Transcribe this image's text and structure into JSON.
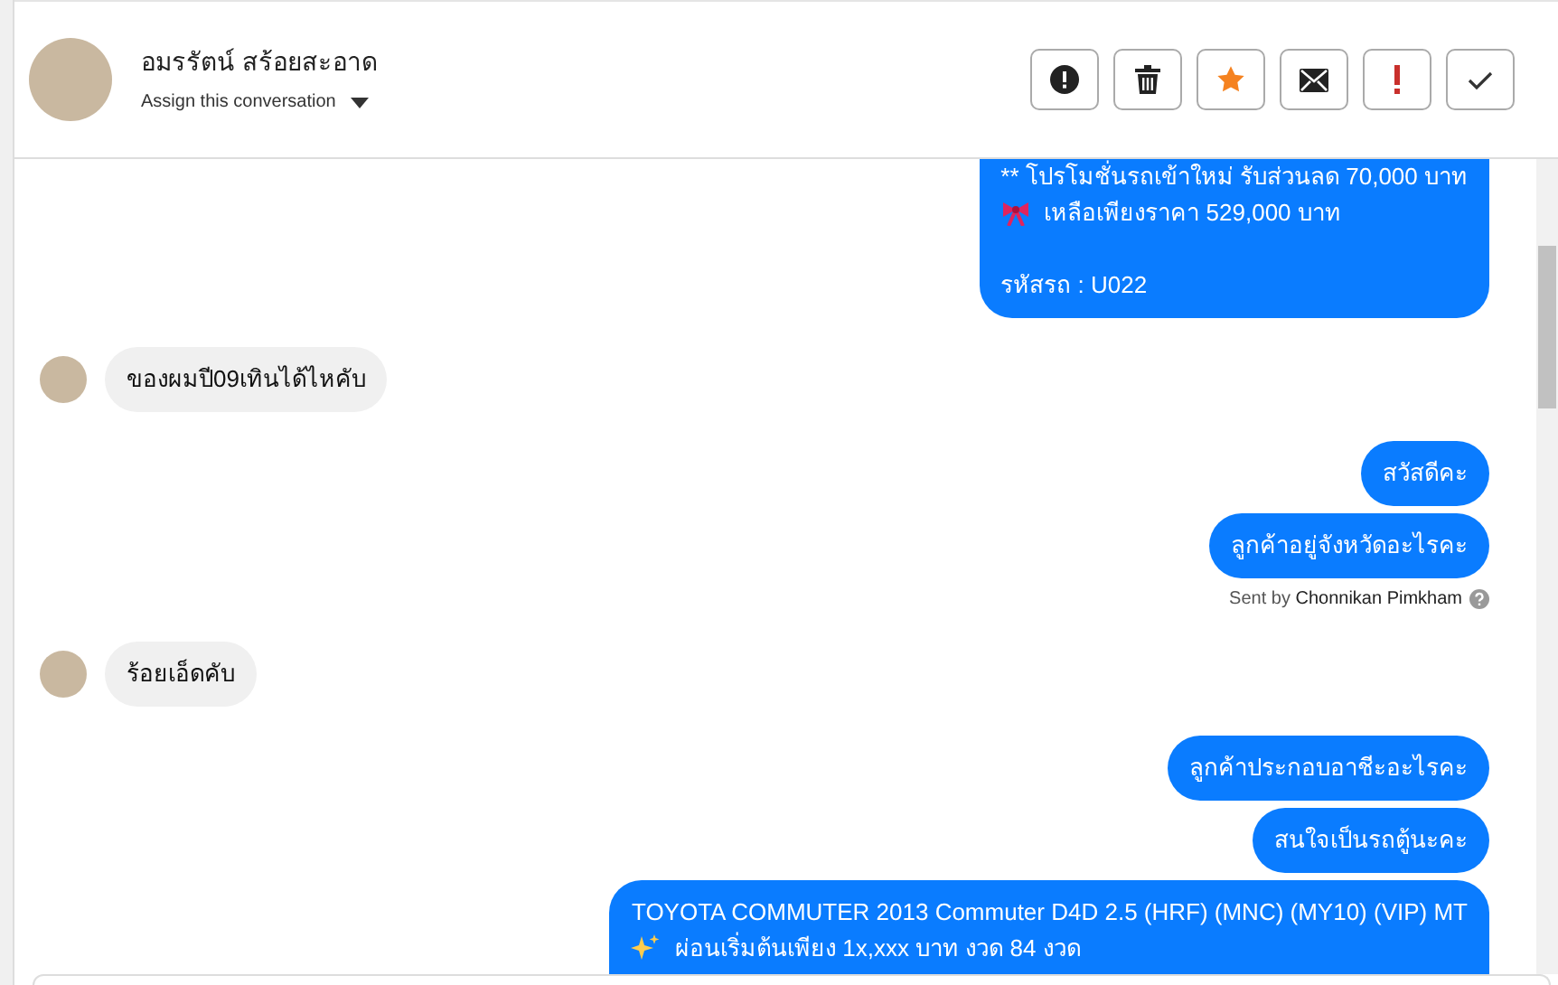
{
  "header": {
    "contact_name": "อมรรัตน์ สร้อยสะอาด",
    "assign_label": "Assign this conversation",
    "actions": [
      {
        "kind": "info"
      },
      {
        "kind": "delete"
      },
      {
        "kind": "star"
      },
      {
        "kind": "mail"
      },
      {
        "kind": "urgent"
      },
      {
        "kind": "check"
      }
    ]
  },
  "messages": [
    {
      "kind": "outgoing",
      "lines": [
        {
          "text": "** โปรโมชั่นรถเข้าใหม่ รับส่วนลด 70,000 บาท"
        },
        {
          "kind": "ribbon",
          "text": "เหลือเพียงราคา 529,000 บาท"
        },
        {
          "kind": "blank"
        },
        {
          "text": "รหัสรถ : U022"
        }
      ]
    },
    {
      "kind": "incoming",
      "lines": [
        {
          "text": "ของผมปี09เทินได้ไหคับ"
        }
      ]
    },
    {
      "kind": "outgoing",
      "lines": [
        {
          "text": "สวัสดีคะ"
        }
      ]
    },
    {
      "kind": "outgoing",
      "lines": [
        {
          "text": "ลูกค้าอยู่จังหวัดอะไรคะ"
        }
      ],
      "sent_by": "Sent by **Chonnikan Pimkham**"
    },
    {
      "kind": "incoming",
      "lines": [
        {
          "text": "ร้อยเอ็ดคับ"
        }
      ]
    },
    {
      "kind": "outgoing",
      "lines": [
        {
          "text": "ลูกค้าประกอบอาชีะอะไรคะ"
        }
      ]
    },
    {
      "kind": "outgoing",
      "lines": [
        {
          "text": "สนใจเป็นรถตู้นะคะ"
        }
      ]
    },
    {
      "kind": "outgoing",
      "lines": [
        {
          "text": "TOYOTA COMMUTER 2013 Commuter D4D 2.5 (HRF) (MNC) (MY10) (VIP) MT"
        },
        {
          "kind": "sparkle",
          "text": "ผ่อนเริ่มต้นเพียง 1x,xxx บาท งวด 84 งวด"
        }
      ]
    }
  ]
}
